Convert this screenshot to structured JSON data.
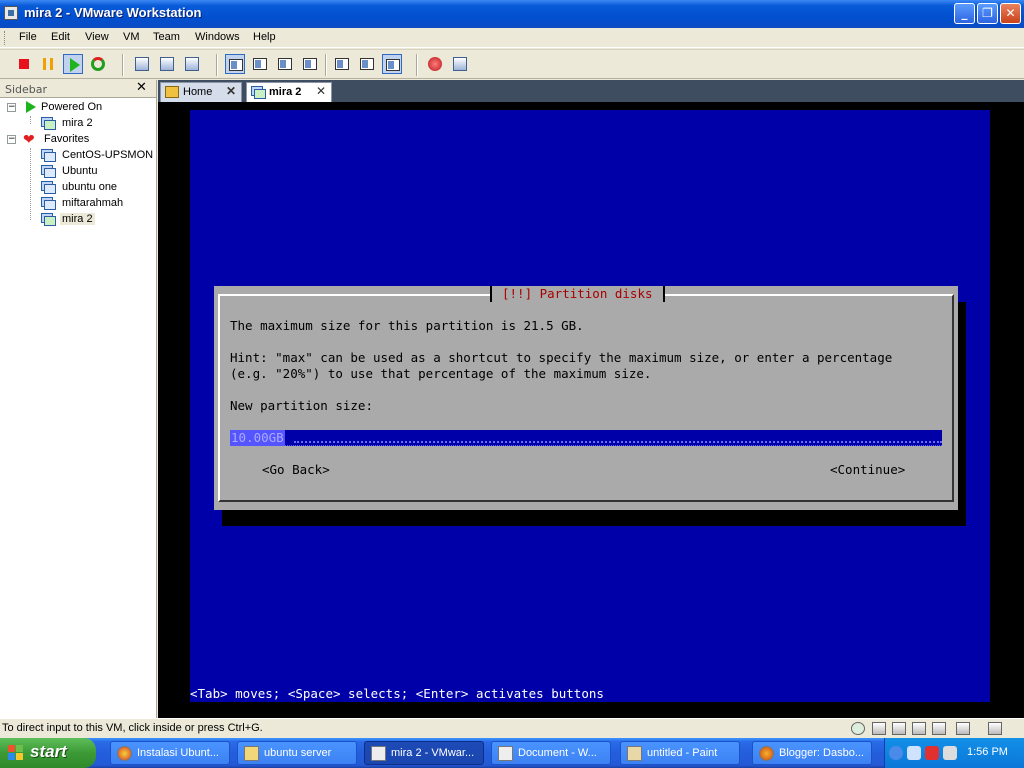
{
  "window": {
    "title": "mira 2 - VMware Workstation",
    "controls": [
      "_",
      "❐",
      "✕"
    ]
  },
  "menu": [
    "File",
    "Edit",
    "View",
    "VM",
    "Team",
    "Windows",
    "Help"
  ],
  "sidebar": {
    "header": "Sidebar",
    "close": "✕",
    "powered_on": {
      "label": "Powered On",
      "items": [
        "mira 2"
      ]
    },
    "favorites": {
      "label": "Favorites",
      "items": [
        "CentOS-UPSMON",
        "Ubuntu",
        "ubuntu one",
        "miftarahmah",
        "mira 2"
      ]
    }
  },
  "tabs": [
    {
      "label": "Home",
      "close": "✕"
    },
    {
      "label": "mira 2",
      "close": "✕"
    }
  ],
  "installer": {
    "title": "[!!] Partition disks",
    "line1": "The maximum size for this partition is 21.5 GB.",
    "hint1": "Hint: \"max\" can be used as a shortcut to specify the maximum size, or enter a percentage",
    "hint2": "(e.g. \"20%\") to use that percentage of the maximum size.",
    "prompt": "New partition size:",
    "value": "10.00GB",
    "go_back": "<Go Back>",
    "continue": "<Continue>",
    "help": "<Tab> moves; <Space> selects; <Enter> activates buttons"
  },
  "statusbar": {
    "text": "To direct input to this VM, click inside or press Ctrl+G."
  },
  "taskbar": {
    "start": "start",
    "tasks": [
      "Instalasi Ubunt...",
      "ubuntu server",
      "mira 2 - VMwar...",
      "Document - W...",
      "untitled - Paint",
      "Blogger: Dasbo..."
    ],
    "clock": "1:56 PM"
  },
  "colors": {
    "installer_bg": "#0000A8",
    "dialog_bg": "#AAAAAA",
    "dialog_title": "#A80000",
    "xp_titlebar": "#0050D0",
    "taskbar": "#245EDC",
    "start_button": "#3C9A36"
  }
}
